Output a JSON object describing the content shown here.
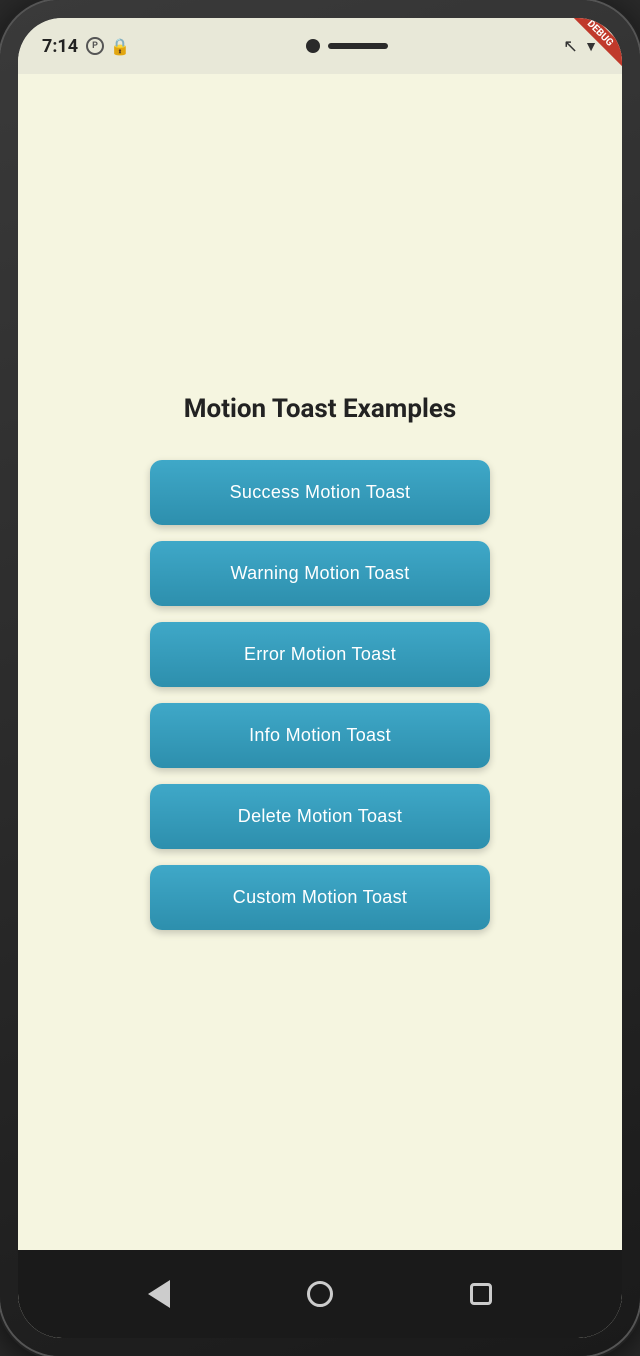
{
  "phone": {
    "status_bar": {
      "time": "7:14",
      "wifi_icon": "▲",
      "debug_label": "DEBUG"
    },
    "page": {
      "title": "Motion Toast Examples",
      "buttons": [
        {
          "id": "success-btn",
          "label": "Success Motion Toast"
        },
        {
          "id": "warning-btn",
          "label": "Warning Motion Toast"
        },
        {
          "id": "error-btn",
          "label": "Error Motion Toast"
        },
        {
          "id": "info-btn",
          "label": "Info Motion Toast"
        },
        {
          "id": "delete-btn",
          "label": "Delete Motion Toast"
        },
        {
          "id": "custom-btn",
          "label": "Custom Motion Toast"
        }
      ]
    },
    "colors": {
      "button_bg": "#3fa8c8",
      "background": "#f5f5e0",
      "accent": "#c0392b"
    }
  }
}
